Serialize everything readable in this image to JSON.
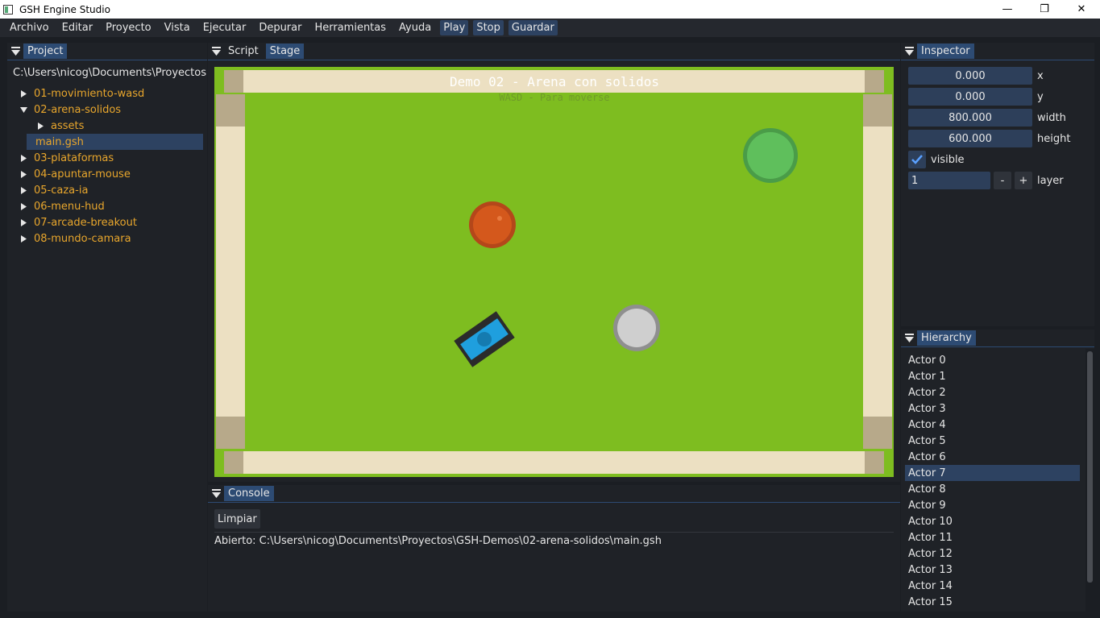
{
  "window": {
    "title": "GSH Engine Studio",
    "minimize": "—",
    "maximize": "❐",
    "close": "✕"
  },
  "menu": {
    "items": [
      "Archivo",
      "Editar",
      "Proyecto",
      "Vista",
      "Ejecutar",
      "Depurar",
      "Herramientas",
      "Ayuda"
    ],
    "buttons": [
      "Play",
      "Stop",
      "Guardar"
    ]
  },
  "project": {
    "tab": "Project",
    "path": "C:\\Users\\nicog\\Documents\\Proyectos\\GSH-Demos",
    "tree": {
      "item0": "01-movimiento-wasd",
      "item1": "02-arena-solidos",
      "item1_child_folder": "assets",
      "item1_child_file": "main.gsh",
      "item2": "03-plataformas",
      "item3": "04-apuntar-mouse",
      "item4": "05-caza-ia",
      "item5": "06-menu-hud",
      "item6": "07-arcade-breakout",
      "item7": "08-mundo-camara"
    }
  },
  "editor": {
    "tab_script": "Script",
    "tab_stage": "Stage",
    "stage_title": "Demo 02 - Arena con solidos",
    "stage_subtitle": "WASD - Para moverse",
    "colors": {
      "grass": "#7ebd20",
      "wall": "#ece0c2",
      "player": "#1f9fde",
      "orb": "#d4581c",
      "bush": "#5fbf5c",
      "rock": "#cfcfcf"
    }
  },
  "console": {
    "tab": "Console",
    "clear_label": "Limpiar",
    "line": "Abierto: C:\\Users\\nicog\\Documents\\Proyectos\\GSH-Demos\\02-arena-solidos\\main.gsh"
  },
  "inspector": {
    "tab": "Inspector",
    "x_value": "0.000",
    "x_label": "x",
    "y_value": "0.000",
    "y_label": "y",
    "width_value": "800.000",
    "width_label": "width",
    "height_value": "600.000",
    "height_label": "height",
    "visible_label": "visible",
    "layer_value": "1",
    "layer_minus": "-",
    "layer_plus": "+",
    "layer_label": "layer"
  },
  "hierarchy": {
    "tab": "Hierarchy",
    "actors": [
      "Actor 0",
      "Actor 1",
      "Actor 2",
      "Actor 3",
      "Actor 4",
      "Actor 5",
      "Actor 6",
      "Actor 7",
      "Actor 8",
      "Actor 9",
      "Actor 10",
      "Actor 11",
      "Actor 12",
      "Actor 13",
      "Actor 14",
      "Actor 15"
    ],
    "selected": "Actor 7"
  }
}
